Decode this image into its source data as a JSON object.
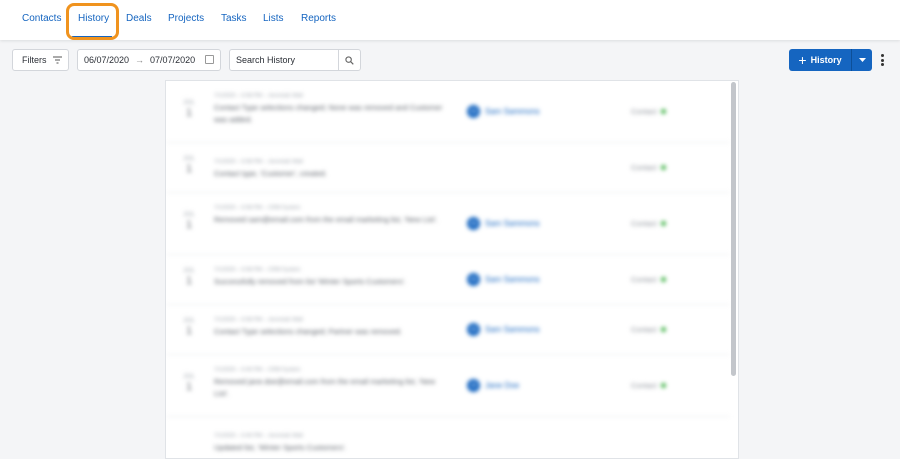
{
  "tabs": [
    {
      "label": "Contacts"
    },
    {
      "label": "History"
    },
    {
      "label": "Deals"
    },
    {
      "label": "Projects"
    },
    {
      "label": "Tasks"
    },
    {
      "label": "Lists"
    },
    {
      "label": "Reports"
    }
  ],
  "active_tab": "History",
  "toolbar": {
    "filters_label": "Filters",
    "date_from": "06/07/2020",
    "date_arrow": "→",
    "date_to": "07/07/2020",
    "search_placeholder": "Search History",
    "add_label": "History"
  },
  "history": [
    {
      "month": "JUL",
      "day": "1",
      "meta": "7/1/2020 – 6:58 PM – Jeremiah Wall",
      "description": "Contact Type selections changed; None was removed and Customer was added.",
      "person": "Sam Sammons",
      "initials": "SS",
      "type": "Contact"
    },
    {
      "month": "JUL",
      "day": "1",
      "meta": "7/1/2020 – 6:58 PM – Jeremiah Wall",
      "description": "Contact type, 'Customer', created.",
      "person": "",
      "initials": "",
      "type": "Contact"
    },
    {
      "month": "JUL",
      "day": "1",
      "meta": "7/1/2020 – 6:58 PM – CRM System",
      "description": "Removed sam@email.com from the email marketing list, 'New List'.",
      "person": "Sam Sammons",
      "initials": "SS",
      "type": "Contact"
    },
    {
      "month": "JUL",
      "day": "1",
      "meta": "7/1/2020 – 6:58 PM – CRM System",
      "description": "Successfully removed from list 'Winter Sports Customers'.",
      "person": "Sam Sammons",
      "initials": "SS",
      "type": "Contact"
    },
    {
      "month": "JUL",
      "day": "1",
      "meta": "7/1/2020 – 6:58 PM – Jeremiah Wall",
      "description": "Contact Type selections changed; Partner was removed.",
      "person": "Sam Sammons",
      "initials": "SS",
      "type": "Contact"
    },
    {
      "month": "JUL",
      "day": "1",
      "meta": "7/1/2020 – 6:40 PM – CRM System",
      "description": "Removed jane.doe@email.com from the email marketing list, 'New List'.",
      "person": "Jane Doe",
      "initials": "JD",
      "type": "Contact"
    },
    {
      "month": "",
      "day": "",
      "meta": "7/1/2020 – 6:40 PM – Jeremiah Wall",
      "description": "Updated list, 'Winter Sports Customers'.",
      "person": "",
      "initials": "",
      "type": ""
    }
  ],
  "colors": {
    "accent": "#1565c0",
    "highlight": "#f0931e",
    "status_dot": "#3cb043"
  }
}
